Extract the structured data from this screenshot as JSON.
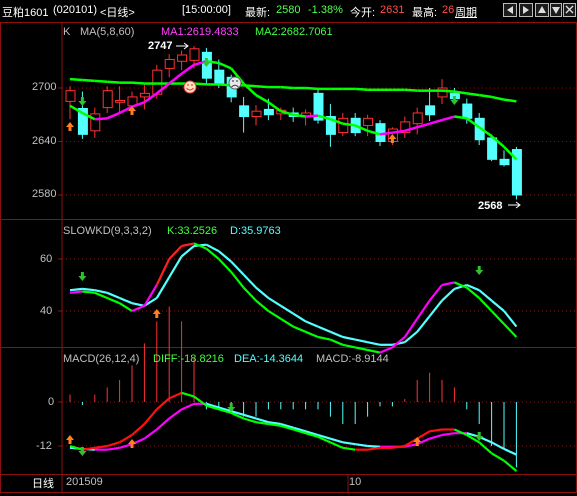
{
  "header": {
    "stock_name": "豆粕1601",
    "stock_code": "(020101)",
    "period": "<日线>",
    "time": "[15:00:00]",
    "latest_label": "最新:",
    "latest_value": "2580",
    "change_pct": "-1.38%",
    "open_label": "今开:",
    "open_value": "2631",
    "high_label": "最高:",
    "high_value": "26",
    "period_button": "周期",
    "nav_buttons": [
      "prev-icon",
      "next-icon",
      "expand-icon",
      "shrink-icon",
      "close-icon"
    ]
  },
  "colors": {
    "up": "#ff3232",
    "down": "#54ffff",
    "ma1": "#ff00ff",
    "ma2": "#00ff00",
    "grid": "#8b1010",
    "axis_text": "#c0c0c0"
  },
  "main_panel": {
    "indicator_prefix": "K",
    "indicator_name": "MA(5,8,60)",
    "ma1_text": "MA1:2619.4833",
    "ma2_text": "MA2:2682.7061",
    "max_annotation": "2747",
    "min_annotation": "2568",
    "y_ticks": [
      "2700",
      "2640",
      "2580"
    ]
  },
  "kd_panel": {
    "title": "SLOWKD(9,3,3,2)",
    "k_text": "K:33.2526",
    "d_text": "D:35.9763",
    "y_ticks": [
      "60",
      "40"
    ]
  },
  "macd_panel": {
    "title": "MACD(26,12,4)",
    "diff_text": "DIFF:-18.8216",
    "dea_text": "DEA:-14.3644",
    "macd_text": "MACD:-8.9144",
    "y_ticks": [
      "0",
      "-12"
    ]
  },
  "footer": {
    "period_label": "日线",
    "date_start": "201509",
    "date_mid": "10"
  },
  "chart_data": {
    "type": "candlestick",
    "candles": [
      {
        "o": 2685,
        "h": 2702,
        "l": 2665,
        "c": 2697
      },
      {
        "o": 2677,
        "h": 2696,
        "l": 2643,
        "c": 2648
      },
      {
        "o": 2652,
        "h": 2678,
        "l": 2644,
        "c": 2671
      },
      {
        "o": 2678,
        "h": 2702,
        "l": 2672,
        "c": 2697
      },
      {
        "o": 2684,
        "h": 2702,
        "l": 2672,
        "c": 2686
      },
      {
        "o": 2680,
        "h": 2696,
        "l": 2676,
        "c": 2690
      },
      {
        "o": 2690,
        "h": 2704,
        "l": 2676,
        "c": 2694
      },
      {
        "o": 2693,
        "h": 2726,
        "l": 2688,
        "c": 2720
      },
      {
        "o": 2722,
        "h": 2738,
        "l": 2712,
        "c": 2732
      },
      {
        "o": 2730,
        "h": 2742,
        "l": 2720,
        "c": 2737
      },
      {
        "o": 2731,
        "h": 2747,
        "l": 2722,
        "c": 2744
      },
      {
        "o": 2740,
        "h": 2745,
        "l": 2704,
        "c": 2711
      },
      {
        "o": 2720,
        "h": 2732,
        "l": 2700,
        "c": 2704
      },
      {
        "o": 2712,
        "h": 2715,
        "l": 2684,
        "c": 2690
      },
      {
        "o": 2680,
        "h": 2690,
        "l": 2650,
        "c": 2668
      },
      {
        "o": 2668,
        "h": 2681,
        "l": 2658,
        "c": 2674
      },
      {
        "o": 2676,
        "h": 2688,
        "l": 2664,
        "c": 2670
      },
      {
        "o": 2671,
        "h": 2678,
        "l": 2664,
        "c": 2675
      },
      {
        "o": 2672,
        "h": 2678,
        "l": 2662,
        "c": 2668
      },
      {
        "o": 2668,
        "h": 2676,
        "l": 2658,
        "c": 2672
      },
      {
        "o": 2694,
        "h": 2700,
        "l": 2660,
        "c": 2664
      },
      {
        "o": 2668,
        "h": 2682,
        "l": 2634,
        "c": 2648
      },
      {
        "o": 2650,
        "h": 2672,
        "l": 2646,
        "c": 2666
      },
      {
        "o": 2666,
        "h": 2672,
        "l": 2646,
        "c": 2650
      },
      {
        "o": 2658,
        "h": 2670,
        "l": 2646,
        "c": 2666
      },
      {
        "o": 2660,
        "h": 2664,
        "l": 2635,
        "c": 2640
      },
      {
        "o": 2640,
        "h": 2656,
        "l": 2636,
        "c": 2654
      },
      {
        "o": 2650,
        "h": 2668,
        "l": 2644,
        "c": 2662
      },
      {
        "o": 2660,
        "h": 2678,
        "l": 2648,
        "c": 2672
      },
      {
        "o": 2680,
        "h": 2700,
        "l": 2663,
        "c": 2670
      },
      {
        "o": 2690,
        "h": 2710,
        "l": 2682,
        "c": 2700
      },
      {
        "o": 2694,
        "h": 2700,
        "l": 2686,
        "c": 2688
      },
      {
        "o": 2682,
        "h": 2688,
        "l": 2660,
        "c": 2666
      },
      {
        "o": 2666,
        "h": 2672,
        "l": 2636,
        "c": 2642
      },
      {
        "o": 2644,
        "h": 2648,
        "l": 2618,
        "c": 2620
      },
      {
        "o": 2620,
        "h": 2630,
        "l": 2612,
        "c": 2614
      },
      {
        "o": 2631,
        "h": 2634,
        "l": 2575,
        "c": 2580
      }
    ],
    "ma1": [
      2680,
      2672,
      2665,
      2666,
      2672,
      2679,
      2684,
      2694,
      2705,
      2716,
      2726,
      2730,
      2728,
      2722,
      2705,
      2692,
      2684,
      2674,
      2670,
      2668,
      2669,
      2665,
      2660,
      2658,
      2652,
      2648,
      2650,
      2652,
      2656,
      2660,
      2664,
      2668,
      2666,
      2656,
      2646,
      2634,
      2620
    ],
    "ma2": [
      2710,
      2709,
      2708,
      2707,
      2706,
      2706,
      2705,
      2705,
      2705,
      2705,
      2705,
      2704,
      2704,
      2703,
      2703,
      2702,
      2701,
      2701,
      2700,
      2700,
      2699,
      2699,
      2699,
      2699,
      2698,
      2698,
      2698,
      2698,
      2697,
      2697,
      2697,
      2696,
      2694,
      2692,
      2690,
      2687,
      2685
    ],
    "kd_k": [
      47,
      47.5,
      47,
      45,
      43,
      40,
      42,
      50,
      60,
      65,
      66,
      64,
      60,
      55,
      49,
      44,
      40,
      37,
      34,
      32,
      30,
      29,
      27,
      26,
      25,
      24,
      26,
      30,
      37,
      44,
      50,
      51,
      49,
      45,
      40,
      35,
      30
    ],
    "kd_d": [
      48,
      48.5,
      48,
      47,
      45,
      43,
      42,
      45,
      53,
      61,
      65,
      65.5,
      63,
      59,
      54,
      49,
      45,
      42,
      39,
      36,
      34,
      32,
      30,
      29,
      28,
      27,
      27,
      28,
      32,
      38,
      44,
      48.5,
      50,
      48,
      44,
      40,
      34
    ],
    "kd_range": [
      25,
      72
    ],
    "macd_diff": [
      -12,
      -13,
      -12.5,
      -12,
      -11,
      -9,
      -6,
      -2,
      1,
      2.5,
      1.5,
      -1,
      -2,
      -3,
      -4.5,
      -5.5,
      -6,
      -6.5,
      -7.5,
      -8.5,
      -9.5,
      -11,
      -12.5,
      -13,
      -13,
      -12.5,
      -12.5,
      -12,
      -10,
      -8,
      -7.5,
      -7.5,
      -9,
      -11,
      -14,
      -16,
      -18.8216
    ],
    "macd_dea": [
      -12.5,
      -12.8,
      -13,
      -13,
      -12.5,
      -11.5,
      -10,
      -7.5,
      -4.5,
      -2,
      -0.5,
      -0.5,
      -1.5,
      -2.5,
      -3.5,
      -4.5,
      -5.5,
      -6,
      -7,
      -8,
      -9,
      -10,
      -11,
      -11.5,
      -12,
      -12.2,
      -12.2,
      -12.2,
      -11.5,
      -10,
      -9,
      -8.5,
      -8.5,
      -9.5,
      -11,
      -12.8,
      -14.3644
    ],
    "macd_hist": [
      0.5,
      -0.2,
      0.5,
      1,
      1.5,
      2.5,
      4,
      5.5,
      6.5,
      5.5,
      3,
      -0.5,
      -0.5,
      -0.5,
      -1,
      -1,
      -0.5,
      -0.5,
      -0.5,
      -0.5,
      -0.5,
      -1,
      -1.5,
      -1.5,
      -1,
      -0.3,
      -0.3,
      0.2,
      1.5,
      2,
      1.5,
      1,
      -0.5,
      -1.5,
      -3,
      -3.2,
      -4.4572
    ],
    "macd_range": [
      -17,
      10
    ]
  }
}
